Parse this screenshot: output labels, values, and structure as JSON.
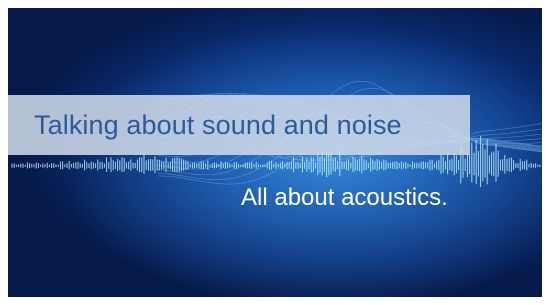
{
  "banner": {
    "title": "Talking about sound and noise",
    "subtitle": "All about acoustics.",
    "colors": {
      "background_center": "#1f63b8",
      "background_edge": "#061a4a",
      "wave_glow": "#7fd4ff",
      "title_box": "#cdd8e8",
      "title_text": "#2e5a9a",
      "subtitle_text": "#ffffff"
    }
  }
}
